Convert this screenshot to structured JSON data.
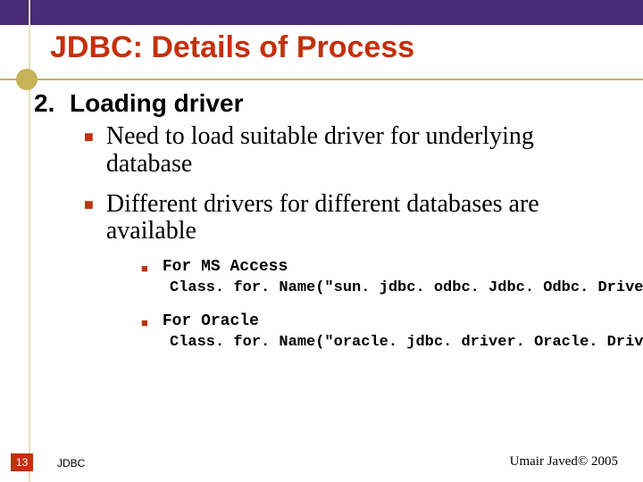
{
  "title": "JDBC: Details of Process",
  "section": {
    "number": "2.",
    "heading": "Loading driver",
    "bullets": [
      "Need to load suitable driver for underlying database",
      "Different drivers for different databases are available"
    ],
    "examples": [
      {
        "label": "For MS Access",
        "code": "Class. for. Name(\"sun. jdbc. odbc. Jdbc. Odbc. Driver\");"
      },
      {
        "label": "For Oracle",
        "code": "Class. for. Name(\"oracle. jdbc. driver. Oracle. Driver \");"
      }
    ]
  },
  "footer": {
    "page": "13",
    "label": "JDBC",
    "copyright": "Umair Javed© 2005"
  }
}
